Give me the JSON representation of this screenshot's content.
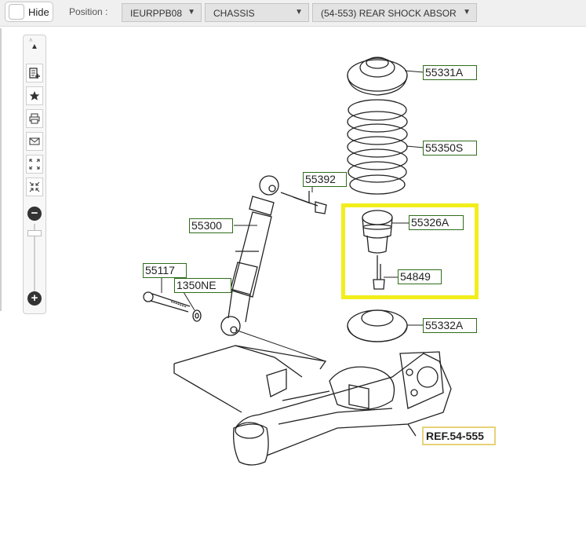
{
  "topbar": {
    "hide_label": "Hide",
    "position_label": "Position :",
    "dropdowns": [
      "IEURPPB08",
      "CHASSIS",
      "(54-553) REAR SHOCK ABSOR"
    ]
  },
  "toolbar": {
    "collapse_glyph": "˄",
    "up_glyph": "▲",
    "zoom_in": "+",
    "zoom_out": "−"
  },
  "callouts": [
    "55331A",
    "55350S",
    "55392",
    "55326A",
    "55300",
    "54849",
    "55117",
    "1350NE",
    "55332A"
  ],
  "ref_label": "REF.54-555",
  "colors": {
    "callout_border": "#2f6d1a",
    "highlight": "#f2ee1c",
    "ref_border": "#e8d27a"
  },
  "icons": [
    "collapse-icon",
    "up-arrow-icon",
    "parts-list-icon",
    "star-icon",
    "print-icon",
    "mail-icon",
    "expand-icon",
    "shrink-icon",
    "zoom-out-icon",
    "zoom-in-icon"
  ]
}
